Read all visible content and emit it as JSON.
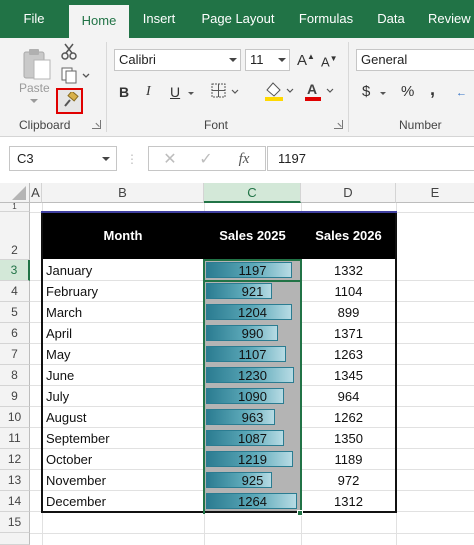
{
  "ribbon": {
    "tabs": [
      "File",
      "Home",
      "Insert",
      "Page Layout",
      "Formulas",
      "Data",
      "Review"
    ],
    "active_tab": "Home",
    "groups": {
      "clipboard": "Clipboard",
      "font": "Font",
      "number": "Number"
    },
    "paste_label": "Paste",
    "font_name": "Calibri",
    "font_size": "11",
    "number_format": "General",
    "bold": "B",
    "italic": "I",
    "underline": "U",
    "grow_font": "A",
    "shrink_font": "A",
    "font_color_letter": "A",
    "currency": "$",
    "percent": "%",
    "comma": ","
  },
  "formula_bar": {
    "name_box": "C3",
    "fx": "fx",
    "value": "1197"
  },
  "grid": {
    "columns": [
      "A",
      "B",
      "C",
      "D",
      "E"
    ],
    "selected_column": "C",
    "selected_row": "3",
    "rows": [
      "1",
      "2",
      "3",
      "4",
      "5",
      "6",
      "7",
      "8",
      "9",
      "10",
      "11",
      "12",
      "13",
      "14",
      "15"
    ],
    "headers": {
      "month": "Month",
      "sales2025": "Sales 2025",
      "sales2026": "Sales 2026"
    },
    "data": [
      {
        "month": "January",
        "s2025": "1197",
        "s2026": "1332",
        "bar": 0.92
      },
      {
        "month": "February",
        "s2025": "921",
        "s2026": "1104",
        "bar": 0.71
      },
      {
        "month": "March",
        "s2025": "1204",
        "s2026": "899",
        "bar": 0.93
      },
      {
        "month": "April",
        "s2025": "990",
        "s2026": "1371",
        "bar": 0.77
      },
      {
        "month": "May",
        "s2025": "1107",
        "s2026": "1263",
        "bar": 0.86
      },
      {
        "month": "June",
        "s2025": "1230",
        "s2026": "1345",
        "bar": 0.95
      },
      {
        "month": "July",
        "s2025": "1090",
        "s2026": "964",
        "bar": 0.84
      },
      {
        "month": "August",
        "s2025": "963",
        "s2026": "1262",
        "bar": 0.74
      },
      {
        "month": "September",
        "s2025": "1087",
        "s2026": "1350",
        "bar": 0.84
      },
      {
        "month": "October",
        "s2025": "1219",
        "s2026": "1189",
        "bar": 0.94
      },
      {
        "month": "November",
        "s2025": "925",
        "s2026": "972",
        "bar": 0.71
      },
      {
        "month": "December",
        "s2025": "1264",
        "s2026": "1312",
        "bar": 0.98
      }
    ]
  },
  "colors": {
    "excel_green": "#217346",
    "bar": "#2b7c91",
    "header_bg": "#000000",
    "highlight": "#e00000"
  }
}
